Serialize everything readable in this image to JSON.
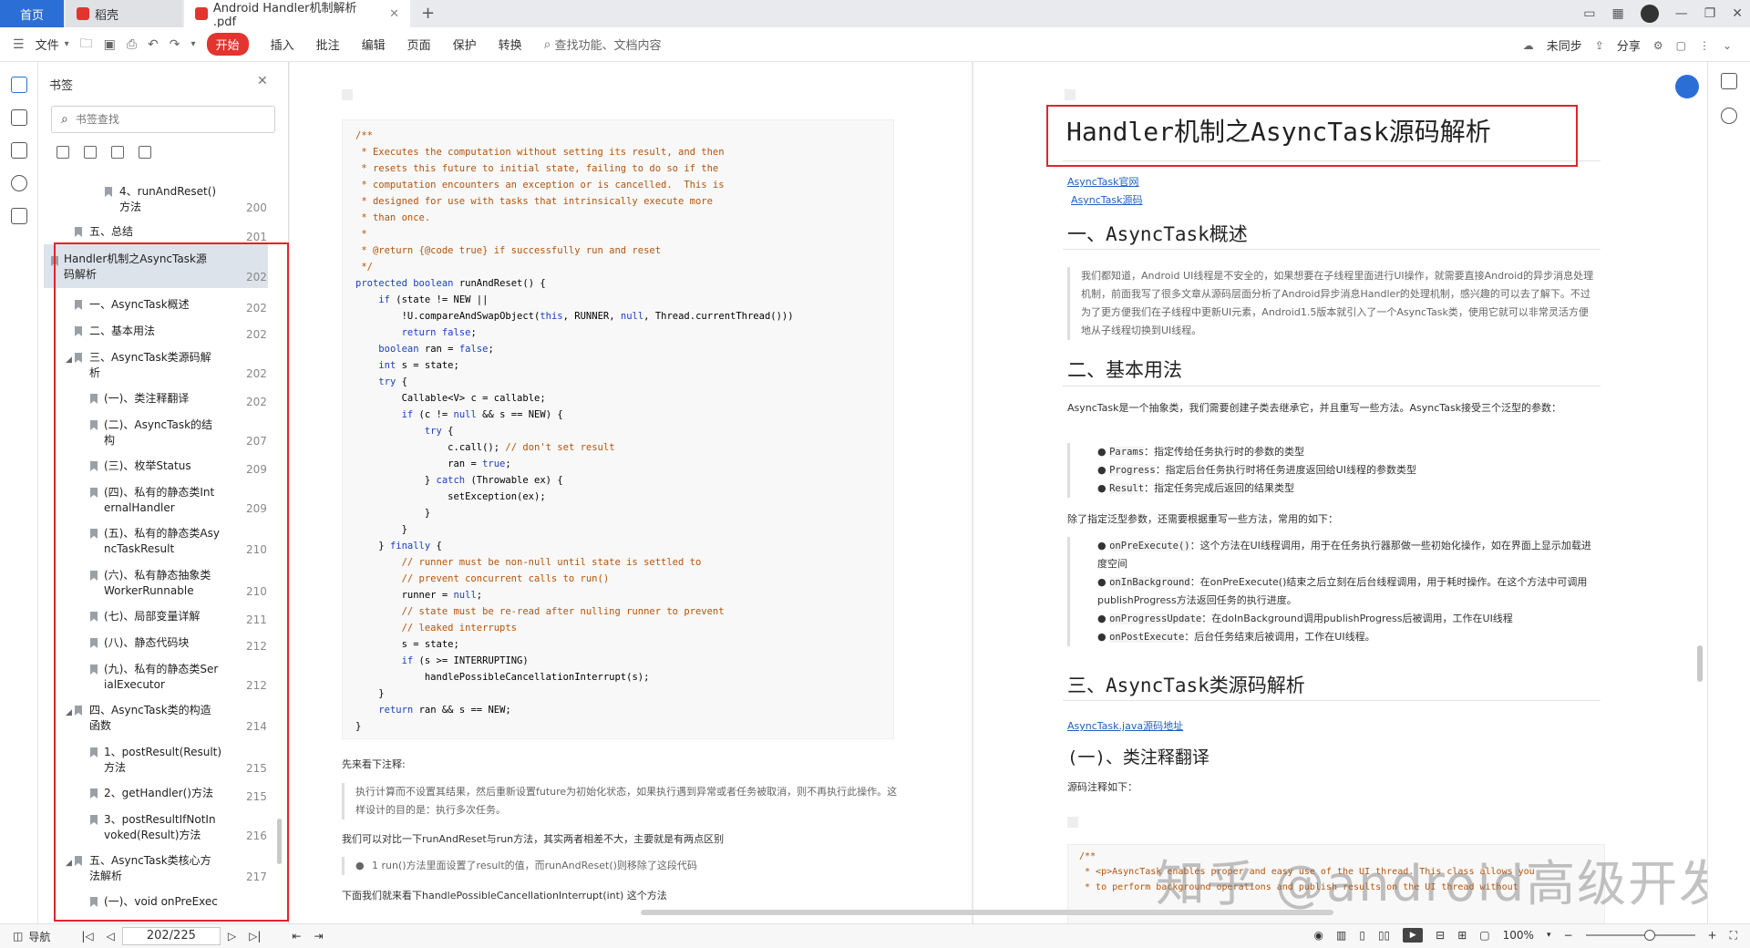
{
  "tabs": {
    "home": "首页",
    "daoke": "稻壳",
    "doc": "Android Handler机制解析 .pdf"
  },
  "toolbar": {
    "file": "文件",
    "start": "开始",
    "insert": "插入",
    "annotate": "批注",
    "edit": "编辑",
    "page": "页面",
    "protect": "保护",
    "convert": "转换",
    "search": "查找功能、文档内容",
    "unsynced": "未同步",
    "share": "分享"
  },
  "bookmarks": {
    "title": "书签",
    "search_placeholder": "书签查找",
    "items": [
      {
        "label": "4、runAndReset()\n方法",
        "page": "200"
      },
      {
        "label": "五、总结",
        "page": "201"
      },
      {
        "label": "Handler机制之AsyncTask源\n码解析",
        "page": "202"
      },
      {
        "label": "一、AsyncTask概述",
        "page": "202"
      },
      {
        "label": "二、基本用法",
        "page": "202"
      },
      {
        "label": "三、AsyncTask类源码解\n析",
        "page": "202"
      },
      {
        "label": "(一)、类注释翻译",
        "page": "202"
      },
      {
        "label": "(二)、AsyncTask的结\n构",
        "page": "207"
      },
      {
        "label": "(三)、枚举Status",
        "page": "209"
      },
      {
        "label": "(四)、私有的静态类Int\nernalHandler",
        "page": "209"
      },
      {
        "label": "(五)、私有的静态类Asy\nncTaskResult",
        "page": "210"
      },
      {
        "label": "(六)、私有静态抽象类\nWorkerRunnable",
        "page": "210"
      },
      {
        "label": "(七)、局部变量详解",
        "page": "211"
      },
      {
        "label": "(八)、静态代码块",
        "page": "212"
      },
      {
        "label": "(九)、私有的静态类Ser\nialExecutor",
        "page": "212"
      },
      {
        "label": "四、AsyncTask类的构造\n函数",
        "page": "214"
      },
      {
        "label": "1、postResult(Result)\n方法",
        "page": "215"
      },
      {
        "label": "2、getHandler()方法",
        "page": "215"
      },
      {
        "label": "3、postResultIfNotIn\nvoked(Result)方法",
        "page": "216"
      },
      {
        "label": "五、AsyncTask类核心方\n法解析",
        "page": "217"
      },
      {
        "label": "(一)、void onPreExec",
        "page": ""
      }
    ]
  },
  "left_page": {
    "code_lines": [
      "/**",
      " * Executes the computation without setting its result, and then",
      " * resets this future to initial state, failing to do so if the",
      " * computation encounters an exception or is cancelled.  This is",
      " * designed for use with tasks that intrinsically execute more",
      " * than once.",
      " *",
      " * @return {@code true} if successfully run and reset",
      " */",
      "protected boolean runAndReset() {",
      "    if (state != NEW ||",
      "        !U.compareAndSwapObject(this, RUNNER, null, Thread.currentThread()))",
      "        return false;",
      "    boolean ran = false;",
      "    int s = state;",
      "    try {",
      "        Callable<V> c = callable;",
      "        if (c != null && s == NEW) {",
      "            try {",
      "                c.call(); // don't set result",
      "                ran = true;",
      "            } catch (Throwable ex) {",
      "                setException(ex);",
      "            }",
      "        }",
      "    } finally {",
      "        // runner must be non-null until state is settled to",
      "        // prevent concurrent calls to run()",
      "        runner = null;",
      "        // state must be re-read after nulling runner to prevent",
      "        // leaked interrupts",
      "        s = state;",
      "        if (s >= INTERRUPTING)",
      "            handlePossibleCancellationInterrupt(s);",
      "    }",
      "    return ran && s == NEW;",
      "}"
    ],
    "p1": "先来看下注释:",
    "quote": "执行计算而不设置其结果，然后重新设置future为初始化状态，如果执行遇到异常或者任务被取消，则不再执行此操作。这样设计的目的是：执行多次任务。",
    "p2": "我们可以对比一下runAndReset与run方法，其实两者相差不大，主要就是有两点区别",
    "li1": "1 run()方法里面设置了result的值，而runAndReset()则移除了这段代码",
    "p3": "下面我们就来看下handlePossibleCancellationInterrupt(int) 这个方法"
  },
  "right_page": {
    "title": "Handler机制之AsyncTask源码解析",
    "link1": "AsyncTask官网",
    "link2": "AsyncTask源码",
    "h1": "一、AsyncTask概述",
    "quote1": "我们都知道，Android UI线程是不安全的，如果想要在子线程里面进行UI操作，就需要直接Android的异步消息处理机制，前面我写了很多文章从源码层面分析了Android异步消息Handler的处理机制，感兴趣的可以去了解下。不过为了更方便我们在子线程中更新UI元素，Android1.5版本就引入了一个AsyncTask类，使用它就可以非常灵活方便地从子线程切换到UI线程。",
    "h2": "二、基本用法",
    "p1": "AsyncTask是一个抽象类，我们需要创建子类去继承它，并且重写一些方法。AsyncTask接受三个泛型的参数：",
    "params": [
      {
        "code": "Params",
        "text": "：指定传给任务执行时的参数的类型"
      },
      {
        "code": "Progress",
        "text": "：指定后台任务执行时将任务进度返回给UI线程的参数类型"
      },
      {
        "code": "Result",
        "text": "：指定任务完成后返回的结果类型"
      }
    ],
    "p2": "除了指定泛型参数，还需要根据重写一些方法，常用的如下：",
    "methods": [
      {
        "code": "onPreExecute()",
        "text": "：这个方法在UI线程调用，用于在任务执行器那做一些初始化操作，如在界面上显示加载进度空间"
      },
      {
        "code": "onInBackground",
        "text": "：在onPreExecute()结束之后立刻在后台线程调用，用于耗时操作。在这个方法中可调用publishProgress方法返回任务的执行进度。"
      },
      {
        "code": "onProgressUpdate",
        "text": "：在doInBackground调用publishProgress后被调用，工作在UI线程"
      },
      {
        "code": "onPostExecute",
        "text": "：后台任务结束后被调用，工作在UI线程。"
      }
    ],
    "h3": "三、AsyncTask类源码解析",
    "link3": "AsyncTask.java源码地址",
    "h4": "(一)、类注释翻译",
    "p3": "源码注释如下：",
    "code1": "/**",
    "code2": " * <p>AsyncTask enables proper and easy use of the UI thread. This class allows you",
    "code3": " * to perform background operations and publish results on the UI thread without"
  },
  "watermark": "知乎 @android高级开发",
  "status": {
    "nav": "导航",
    "page": "202/225",
    "zoom": "100%"
  }
}
